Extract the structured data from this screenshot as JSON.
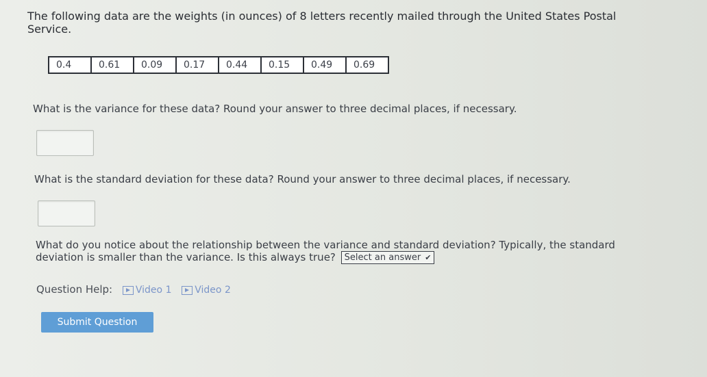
{
  "intro_text": "The following data are the weights (in ounces) of 8 letters recently mailed through the United States Postal Service.",
  "data_values": [
    "0.4",
    "0.61",
    "0.09",
    "0.17",
    "0.44",
    "0.15",
    "0.49",
    "0.69"
  ],
  "q1": {
    "text": "What is the variance for these data? Round your answer to three decimal places, if necessary.",
    "answer": ""
  },
  "q2": {
    "text": "What is the standard deviation for these data? Round your answer to three decimal places, if necessary.",
    "answer": ""
  },
  "q3": {
    "text": "What do you notice about the relationship between the variance and standard deviation? Typically, the standard deviation is smaller than the variance. Is this always true?",
    "select_value": "Select an answer"
  },
  "help": {
    "label": "Question Help:",
    "video1": "Video 1",
    "video2": "Video 2"
  },
  "submit_label": "Submit Question"
}
